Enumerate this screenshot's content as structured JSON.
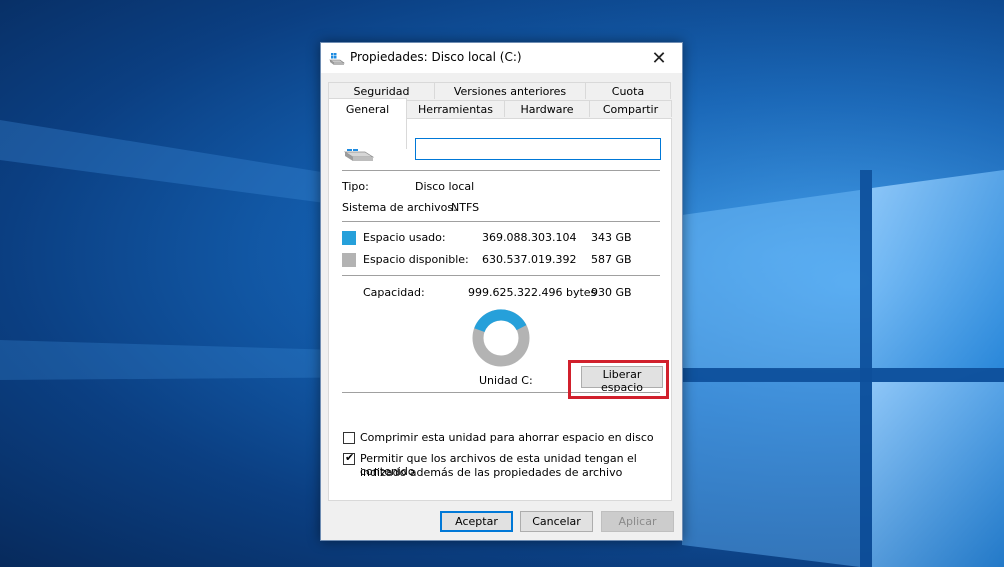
{
  "window": {
    "title": "Propiedades: Disco local (C:)",
    "close_glyph": "✕"
  },
  "tabs_row1": [
    "Seguridad",
    "Versiones anteriores",
    "Cuota"
  ],
  "tabs_row2": [
    "General",
    "Herramientas",
    "Hardware",
    "Compartir"
  ],
  "active_tab": "General",
  "general": {
    "name_value": "",
    "tipo_label": "Tipo:",
    "tipo_value": "Disco local",
    "fs_label": "Sistema de archivos:",
    "fs_value": "NTFS",
    "used_label": "Espacio usado:",
    "used_bytes": "369.088.303.104",
    "used_gb": "343 GB",
    "free_label": "Espacio disponible:",
    "free_bytes": "630.537.019.392",
    "free_gb": "587 GB",
    "capacity_label": "Capacidad:",
    "capacity_bytes": "999.625.322.496 bytes",
    "capacity_gb": "930 GB",
    "drive_label": "Unidad C:",
    "cleanup_button": "Liberar espacio",
    "compress_label": "Comprimir esta unidad para ahorrar espacio en disco",
    "compress_checked": false,
    "index_label_line1": "Permitir que los archivos de esta unidad tengan el contenido",
    "index_label_line2": "indizado además de las propiedades de archivo",
    "index_checked": true,
    "usage_fraction": 0.369
  },
  "buttons": {
    "ok": "Aceptar",
    "cancel": "Cancelar",
    "apply": "Aplicar"
  },
  "colors": {
    "used": "#26a0da",
    "free": "#b3b3b3",
    "highlight": "#d1202c"
  },
  "icons": {
    "title_icon": "drive-icon",
    "drive_icon": "windows-drive-icon"
  }
}
